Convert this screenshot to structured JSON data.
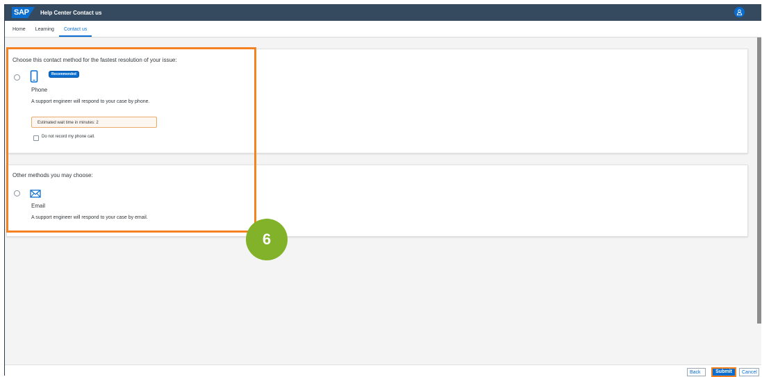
{
  "shell": {
    "logo_text": "SAP",
    "title": "Help Center Contact us",
    "avatar_icon": "person-icon"
  },
  "tabs": [
    {
      "label": "Home",
      "active": false
    },
    {
      "label": "Learning",
      "active": false
    },
    {
      "label": "Contact us",
      "active": true
    }
  ],
  "fastest_section": {
    "heading": "Choose this contact method for the fastest resolution of your issue:",
    "method": {
      "icon": "phone-icon",
      "badge": "Recommended",
      "label": "Phone",
      "description": "A support engineer will respond to your case by phone.",
      "wait_time_text": "Estimated wait time in minutes: 2",
      "checkbox_label": "Do not record my phone call."
    }
  },
  "other_section": {
    "heading": "Other methods you may choose:",
    "method": {
      "icon": "mail-icon",
      "label": "Email",
      "description": "A support engineer will respond to your case by email."
    }
  },
  "annotation": {
    "step_number": "6",
    "highlight_color": "#f58220",
    "step_color": "#82b22a"
  },
  "footer": {
    "back_label": "Back",
    "submit_label": "Submit",
    "cancel_label": "Cancel"
  },
  "colors": {
    "shell_bg": "#354a5f",
    "accent": "#0a6ed1"
  }
}
